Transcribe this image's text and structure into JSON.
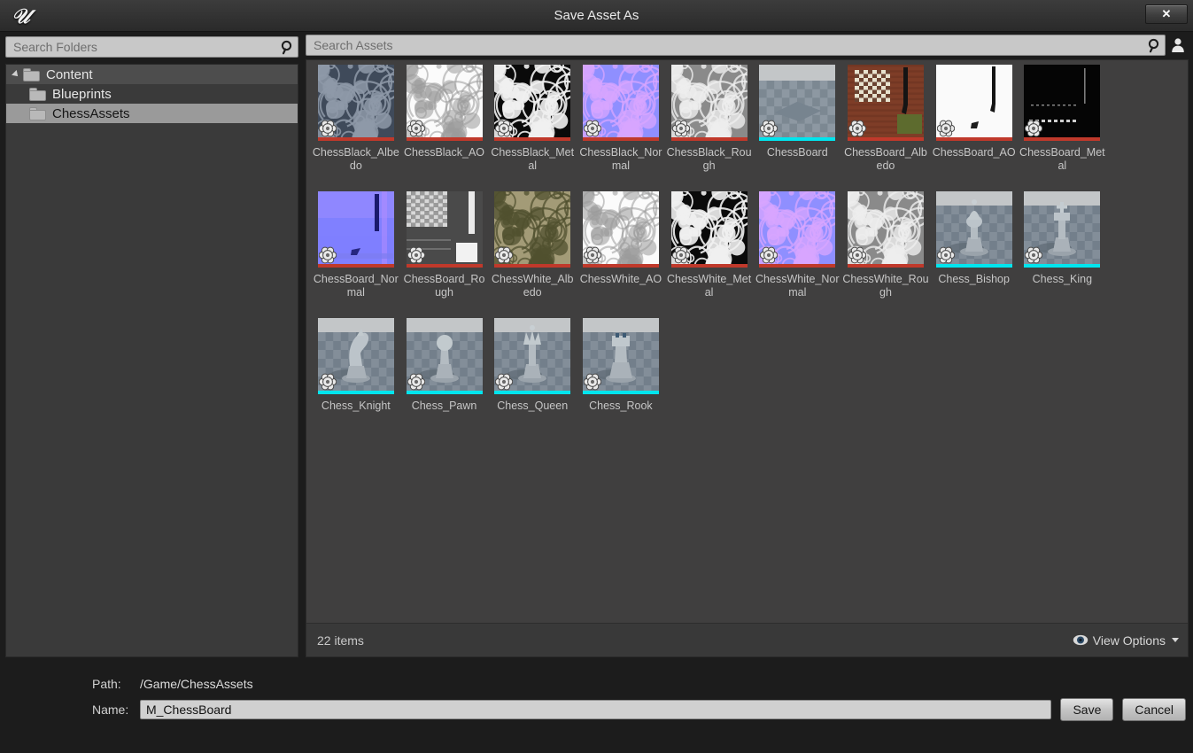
{
  "window": {
    "title": "Save Asset As",
    "logo_icon": "unreal-engine-logo",
    "close_label": "✕"
  },
  "folder_search": {
    "placeholder": "Search Folders",
    "value": "",
    "icon": "search-icon"
  },
  "asset_search": {
    "placeholder": "Search Assets",
    "value": "",
    "icon": "search-icon",
    "user_icon": "person-icon"
  },
  "tree": {
    "items": [
      {
        "label": "Content",
        "depth": 0,
        "expanded": true,
        "selected": false,
        "header": true
      },
      {
        "label": "Blueprints",
        "depth": 1,
        "expanded": false,
        "selected": false,
        "header": false
      },
      {
        "label": "ChessAssets",
        "depth": 1,
        "expanded": false,
        "selected": true,
        "header": false
      }
    ]
  },
  "assets": {
    "colors": {
      "texture_bar": "#c0392b",
      "mesh_bar": "#00e5ee"
    },
    "items": [
      {
        "label": "ChessBlack_Albedo",
        "type": "texture",
        "thumb": "swirl-dark-blue"
      },
      {
        "label": "ChessBlack_AO",
        "type": "texture",
        "thumb": "swirl-white"
      },
      {
        "label": "ChessBlack_Metal",
        "type": "texture",
        "thumb": "swirl-blackwhite"
      },
      {
        "label": "ChessBlack_Normal",
        "type": "texture",
        "thumb": "swirl-normal"
      },
      {
        "label": "ChessBlack_Rough",
        "type": "texture",
        "thumb": "swirl-gray"
      },
      {
        "label": "ChessBoard",
        "type": "mesh",
        "thumb": "board-mesh"
      },
      {
        "label": "ChessBoard_Albedo",
        "type": "texture",
        "thumb": "board-wood"
      },
      {
        "label": "ChessBoard_AO",
        "type": "texture",
        "thumb": "board-white"
      },
      {
        "label": "ChessBoard_Metal",
        "type": "texture",
        "thumb": "board-black"
      },
      {
        "label": "ChessBoard_Normal",
        "type": "texture",
        "thumb": "board-normal"
      },
      {
        "label": "ChessBoard_Rough",
        "type": "texture",
        "thumb": "board-checker-gray"
      },
      {
        "label": "ChessWhite_Albedo",
        "type": "texture",
        "thumb": "swirl-tan"
      },
      {
        "label": "ChessWhite_AO",
        "type": "texture",
        "thumb": "swirl-white"
      },
      {
        "label": "ChessWhite_Metal",
        "type": "texture",
        "thumb": "swirl-blackwhite"
      },
      {
        "label": "ChessWhite_Normal",
        "type": "texture",
        "thumb": "swirl-normal"
      },
      {
        "label": "ChessWhite_Rough",
        "type": "texture",
        "thumb": "swirl-gray"
      },
      {
        "label": "Chess_Bishop",
        "type": "mesh",
        "thumb": "piece-bishop"
      },
      {
        "label": "Chess_King",
        "type": "mesh",
        "thumb": "piece-king"
      },
      {
        "label": "Chess_Knight",
        "type": "mesh",
        "thumb": "piece-knight"
      },
      {
        "label": "Chess_Pawn",
        "type": "mesh",
        "thumb": "piece-pawn"
      },
      {
        "label": "Chess_Queen",
        "type": "mesh",
        "thumb": "piece-queen"
      },
      {
        "label": "Chess_Rook",
        "type": "mesh",
        "thumb": "piece-rook"
      }
    ]
  },
  "footer": {
    "item_count": "22 items",
    "view_options_label": "View Options",
    "view_options_icon": "eye-icon",
    "caret_icon": "chevron-down-icon"
  },
  "form": {
    "path_label": "Path:",
    "path_value": "/Game/ChessAssets",
    "name_label": "Name:",
    "name_value": "M_ChessBoard",
    "name_placeholder": "",
    "save_label": "Save",
    "cancel_label": "Cancel"
  }
}
